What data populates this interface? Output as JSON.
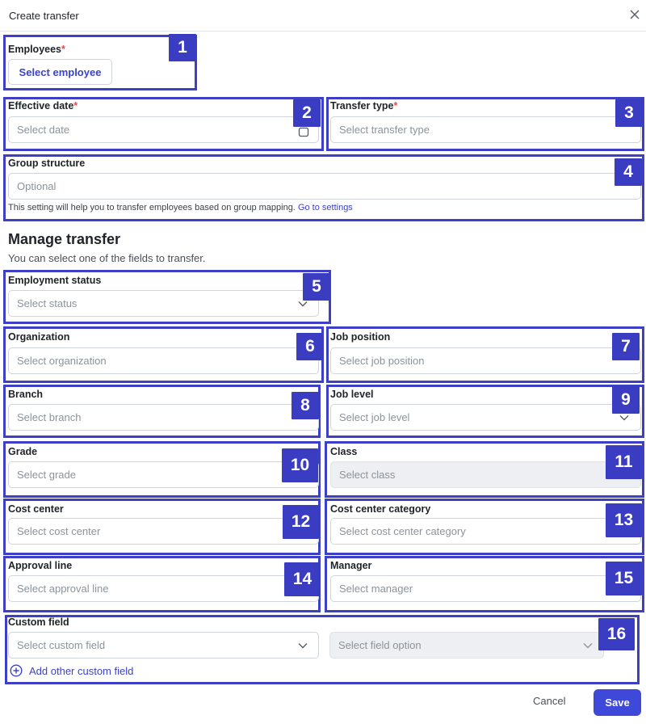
{
  "dialog": {
    "title": "Create transfer",
    "close_icon": "close-icon"
  },
  "employees": {
    "label": "Employees",
    "required": "*",
    "button": "Select employee"
  },
  "effective_date": {
    "label": "Effective date",
    "required": "*",
    "placeholder": "Select date",
    "icon": "calendar-icon"
  },
  "transfer_type": {
    "label": "Transfer type",
    "required": "*",
    "placeholder": "Select transfer type"
  },
  "group_structure": {
    "label": "Group structure",
    "placeholder": "Optional",
    "helper": "This setting will help you to transfer employees based on group mapping.",
    "helper_link": "Go to settings"
  },
  "manage": {
    "title": "Manage transfer",
    "subtitle": "You can select one of the fields to transfer."
  },
  "employment_status": {
    "label": "Employment status",
    "placeholder": "Select status"
  },
  "organization": {
    "label": "Organization",
    "placeholder": "Select organization"
  },
  "job_position": {
    "label": "Job position",
    "placeholder": "Select job position"
  },
  "branch": {
    "label": "Branch",
    "placeholder": "Select branch"
  },
  "job_level": {
    "label": "Job level",
    "placeholder": "Select job level"
  },
  "grade": {
    "label": "Grade",
    "placeholder": "Select grade"
  },
  "class": {
    "label": "Class",
    "placeholder": "Select class"
  },
  "cost_center": {
    "label": "Cost center",
    "placeholder": "Select cost center"
  },
  "cost_center_category": {
    "label": "Cost center category",
    "placeholder": "Select cost center category"
  },
  "approval_line": {
    "label": "Approval line",
    "placeholder": "Select approval line"
  },
  "manager": {
    "label": "Manager",
    "placeholder": "Select manager"
  },
  "custom_field": {
    "label": "Custom field",
    "field_placeholder": "Select custom field",
    "option_placeholder": "Select field option",
    "add_link": "Add other custom field",
    "add_icon": "plus-circle-icon"
  },
  "footer": {
    "cancel": "Cancel",
    "save": "Save"
  },
  "badges": [
    "1",
    "2",
    "3",
    "4",
    "5",
    "6",
    "7",
    "8",
    "9",
    "10",
    "11",
    "12",
    "13",
    "14",
    "15",
    "16"
  ],
  "colors": {
    "annotation": "#3a3dc2",
    "accent": "#3b43c8",
    "required": "#e5484d",
    "primary_button": "#3e48d9"
  }
}
